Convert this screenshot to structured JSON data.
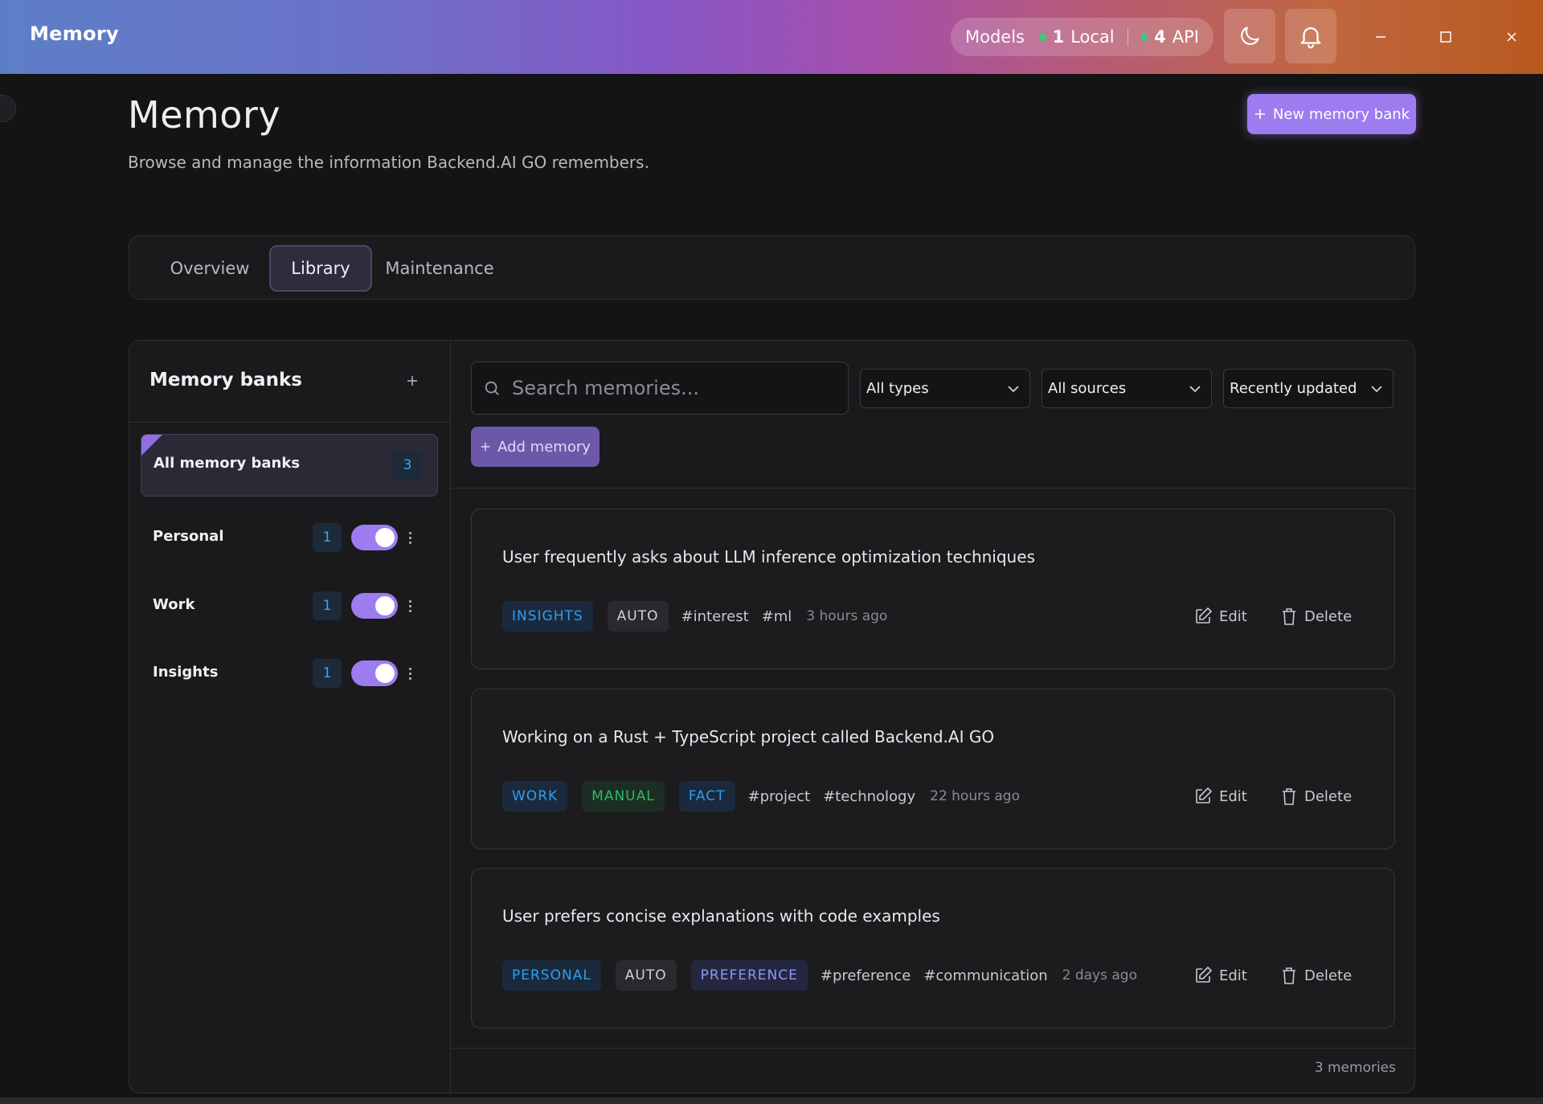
{
  "window": {
    "title": "Memory",
    "models_label": "Models",
    "local_count": "1",
    "local_label": "Local",
    "api_count": "4",
    "api_label": "API",
    "status_color": "#2fd17a"
  },
  "page": {
    "title": "Memory",
    "subtitle": "Browse and manage the information Backend.AI GO remembers.",
    "new_bank_label": "New memory bank"
  },
  "tabs": [
    {
      "label": "Overview",
      "active": false
    },
    {
      "label": "Library",
      "active": true
    },
    {
      "label": "Maintenance",
      "active": false
    }
  ],
  "banks": {
    "title": "Memory banks",
    "all": {
      "label": "All memory banks",
      "count": "3"
    },
    "items": [
      {
        "label": "Personal",
        "count": "1",
        "enabled": true
      },
      {
        "label": "Work",
        "count": "1",
        "enabled": true
      },
      {
        "label": "Insights",
        "count": "1",
        "enabled": true
      }
    ]
  },
  "filters": {
    "search_placeholder": "Search memories...",
    "type": "All types",
    "source": "All sources",
    "sort": "Recently updated",
    "add_label": "Add memory"
  },
  "memories": [
    {
      "text": "User frequently asks about LLM inference optimization techniques",
      "badges": [
        {
          "label": "INSIGHTS",
          "color": "blue"
        },
        {
          "label": "AUTO",
          "color": "gray"
        }
      ],
      "tags": [
        "#interest",
        "#ml"
      ],
      "time": "3 hours ago"
    },
    {
      "text": "Working on a Rust + TypeScript project called Backend.AI GO",
      "badges": [
        {
          "label": "WORK",
          "color": "blue"
        },
        {
          "label": "MANUAL",
          "color": "green"
        },
        {
          "label": "FACT",
          "color": "blue"
        }
      ],
      "tags": [
        "#project",
        "#technology"
      ],
      "time": "22 hours ago"
    },
    {
      "text": "User prefers concise explanations with code examples",
      "badges": [
        {
          "label": "PERSONAL",
          "color": "blue"
        },
        {
          "label": "AUTO",
          "color": "gray"
        },
        {
          "label": "PREFERENCE",
          "color": "purple"
        }
      ],
      "tags": [
        "#preference",
        "#communication"
      ],
      "time": "2 days ago"
    }
  ],
  "actions": {
    "edit": "Edit",
    "delete": "Delete"
  },
  "footer": {
    "count_label": "3 memories"
  },
  "colors": {
    "accent": "#9d7cf0",
    "badge_blue": "#2f9df0",
    "badge_green": "#2fb866",
    "badge_purple": "#8d98f5"
  }
}
